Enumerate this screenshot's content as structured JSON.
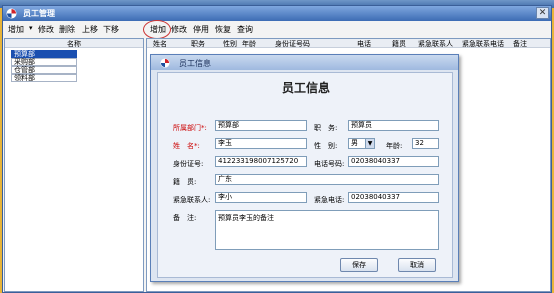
{
  "main_window": {
    "title": "员工管理",
    "close_label": "✕"
  },
  "left_toolbar": {
    "add": "增加",
    "dropdown": "▾",
    "edit": "修改",
    "delete": "删除",
    "up": "上移",
    "down": "下移"
  },
  "dept_list": {
    "header": "名称",
    "items": [
      "预算部",
      "采购部",
      "仓管部",
      "领料部"
    ],
    "selected_index": 0
  },
  "right_toolbar": {
    "add": "增加",
    "edit": "修改",
    "disable": "停用",
    "restore": "恢复",
    "query": "查询"
  },
  "grid": {
    "columns": [
      "姓名",
      "职务",
      "性别",
      "年龄",
      "身份证号码",
      "电话",
      "籍贯",
      "紧急联系人",
      "紧急联系电话",
      "备注"
    ]
  },
  "dialog": {
    "title": "员工信息",
    "heading": "员工信息",
    "labels": {
      "department": "所属部门*:",
      "position": "职　务:",
      "name": "姓　名*:",
      "gender": "性　别:",
      "age": "年龄:",
      "id_number": "身份证号:",
      "phone": "电话号码:",
      "hometown": "籍　贯:",
      "emergency_contact": "紧急联系人:",
      "emergency_phone": "紧急电话:",
      "remarks": "备　注:"
    },
    "values": {
      "department": "预算部",
      "position": "预算员",
      "name": "李玉",
      "gender": "男",
      "age": "32",
      "id_number": "412233198007125720",
      "phone": "02038040337",
      "hometown": "广东",
      "emergency_contact": "李小",
      "emergency_phone": "02038040337",
      "remarks": "预算员李玉的备注"
    },
    "buttons": {
      "save": "保存",
      "cancel": "取消"
    }
  }
}
